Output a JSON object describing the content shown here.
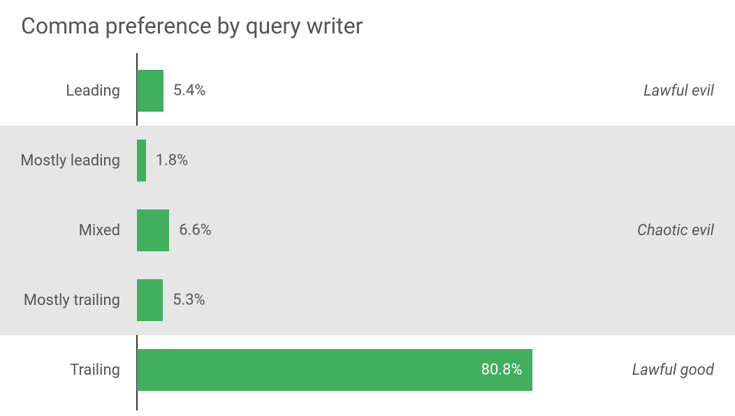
{
  "title": "Comma preference by query writer",
  "chart_data": {
    "type": "bar",
    "orientation": "horizontal",
    "xlabel": "",
    "ylabel": "",
    "xlim": [
      0,
      100
    ],
    "categories": [
      "Leading",
      "Mostly leading",
      "Mixed",
      "Mostly trailing",
      "Trailing"
    ],
    "values": [
      5.4,
      1.8,
      6.6,
      5.3,
      80.8
    ],
    "value_labels": [
      "5.4%",
      "1.8%",
      "6.6%",
      "5.3%",
      "80.8%"
    ],
    "annotations": [
      "Lawful evil",
      "",
      "Chaotic evil",
      "",
      "Lawful good"
    ],
    "bar_color": "#41af5e",
    "banding": [
      false,
      true,
      true,
      true,
      false
    ]
  }
}
